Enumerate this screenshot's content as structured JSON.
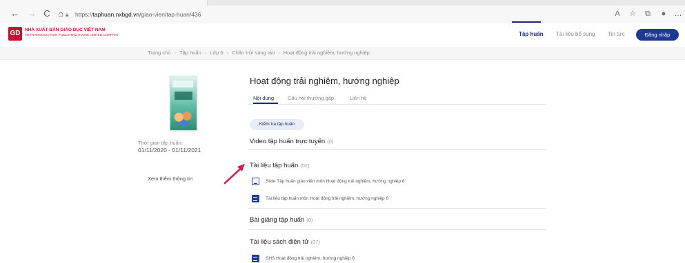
{
  "browser": {
    "back_icon": "←",
    "forward_icon": "→",
    "reload_icon": "C",
    "home_icon": "⌂",
    "url_scheme": "https://",
    "url_host": "taphuan.nxbgd.vn",
    "url_path": "/giao-vien/tap-huan/436"
  },
  "site": {
    "logo_mark": "GD",
    "logo_name": "NHÀ XUẤT BẢN GIÁO DỤC VIỆT NAM",
    "logo_sub": "VIETNAM EDUCATION PUBLISHING HOUSE LIMITED COMPANY",
    "nav": {
      "training": "Tập huấn",
      "resources": "Tài liệu bổ sung",
      "news": "Tin tức",
      "login": "Đăng nhập"
    },
    "accent": "#1f3a93",
    "brand": "#c8102e"
  },
  "breadcrumb": [
    "Trang chủ",
    "Tập huấn",
    "Lớp 6",
    "Chân trời sáng tạo",
    "Hoạt động trải nghiệm, hướng nghiệp"
  ],
  "breadcrumb_sep": "›",
  "sidebar": {
    "time_label": "Thời gian tập huấn:",
    "time_value": "01/11/2020 - 01/11/2021",
    "more_info": "Xem thêm thông tin"
  },
  "main": {
    "title": "Hoạt động trải nghiệm, hướng nghiệp",
    "tabs": [
      "Nội dung",
      "Câu hỏi thường gặp",
      "Liên hệ"
    ],
    "check_button": "Kiểm tra tập huấn",
    "sections": [
      {
        "title": "Video tập huấn trực tuyến",
        "count": "(0)"
      },
      {
        "title": "Tài liệu tập huấn",
        "count": "(02)"
      },
      {
        "title": "Bài giảng tập huấn",
        "count": "(0)"
      },
      {
        "title": "Tài liệu sách điện tử",
        "count": "(07)"
      }
    ],
    "documents": [
      {
        "icon": "slide-icon",
        "label": "Slide Tập huấn giáo viên môn Hoạt động trải nghiệm, hướng nghiệp 6"
      },
      {
        "icon": "document-icon",
        "label": "Tài liệu tập huấn môn Hoạt động trải nghiệm, hướng nghiệp 6"
      }
    ],
    "ebooks": [
      {
        "icon": "document-icon",
        "label": "SHS Hoạt động trải nghiệm, hướng nghiệp 6"
      }
    ]
  }
}
